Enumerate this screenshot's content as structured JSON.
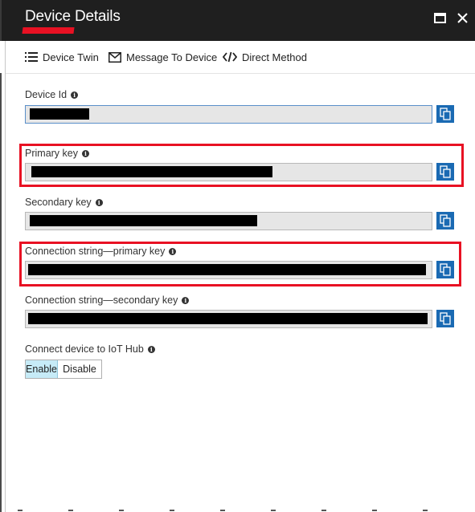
{
  "window": {
    "title": "Device Details",
    "maximize_icon": "maximize-icon",
    "close_icon": "close-icon"
  },
  "toolbar": {
    "device_twin": "Device Twin",
    "message_to_device": "Message To Device",
    "direct_method": "Direct Method"
  },
  "fields": {
    "device_id": {
      "label": "Device Id"
    },
    "primary_key": {
      "label": "Primary key"
    },
    "secondary_key": {
      "label": "Secondary key"
    },
    "conn_primary": {
      "label": "Connection string—primary key"
    },
    "conn_secondary": {
      "label": "Connection string—secondary key"
    }
  },
  "connect": {
    "label": "Connect device to IoT Hub",
    "enable": "Enable",
    "disable": "Disable",
    "selected": "Enable"
  },
  "colors": {
    "highlight": "#e81123",
    "accent_button": "#1a6ab3",
    "titlebar": "#1f1f1f",
    "toggle_selected": "#c6ebf7"
  }
}
